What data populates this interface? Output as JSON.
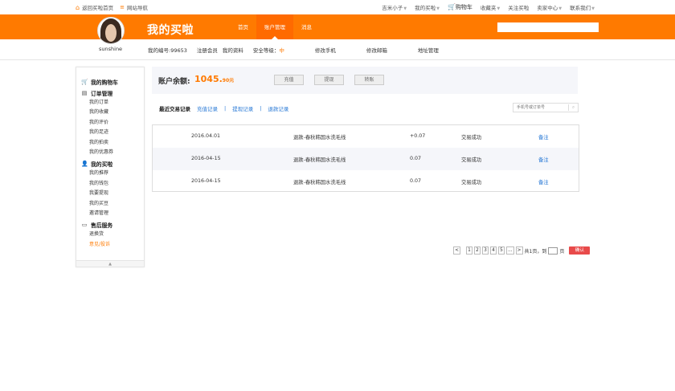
{
  "topbar": {
    "home_link": "返回买啦首页",
    "site_nav": "网站导航",
    "user": "吉米小子",
    "my_maila": "我的买啦",
    "cart": "购物车",
    "favorites": "收藏夹",
    "follow": "关注买啦",
    "seller_center": "卖家中心",
    "contact": "联系我们"
  },
  "header": {
    "logo": "我的买啦",
    "nav": [
      "首页",
      "账户管理",
      "消息"
    ],
    "active_index": 1,
    "accent": "#ff7a00"
  },
  "subbar": {
    "username": "sunshine",
    "member_no": "我的编号:99653",
    "register_member": "注册会员",
    "my_profile": "我的资料",
    "security_label": "安全等级：",
    "security_value": "中",
    "change_phone": "修改手机",
    "change_email": "修改邮箱",
    "address": "地址管理"
  },
  "sidebar": {
    "sections": [
      {
        "title": "我的购物车",
        "icon": "cart-icon",
        "items": []
      },
      {
        "title": "订单管理",
        "icon": "document-icon",
        "items": [
          "我的订单",
          "我的收藏",
          "我的评价",
          "我的足迹",
          "我的拍卖",
          "我的优惠券"
        ]
      },
      {
        "title": "我的买啦",
        "icon": "user-icon",
        "items": [
          "我的推荐",
          "我的钱包",
          "我要提现",
          "我的买豆",
          "邀请管理"
        ]
      },
      {
        "title": "售后服务",
        "icon": "card-icon",
        "items": [
          "退换货",
          "意见/投诉"
        ]
      }
    ],
    "highlight_item": "意见/投诉"
  },
  "balance": {
    "label": "账户余额:",
    "amount": "1045.",
    "amount_suffix": "90元",
    "btn_recharge": "充值",
    "btn_withdraw": "提现",
    "btn_transfer": "转账"
  },
  "records": {
    "title": "最近交易记录",
    "tabs": [
      "充值记录",
      "提现记录",
      "退款记录"
    ],
    "search_placeholder": "手机号或订单号"
  },
  "table": {
    "rows": [
      {
        "date": "2016.04.01",
        "desc": "退款-春秋韩国水洗毛线",
        "amount": "+0.07",
        "status": "交易成功",
        "note": "备注"
      },
      {
        "date": "2016-04-15",
        "desc": "退款-春秋韩国水洗毛线",
        "amount": "0.07",
        "status": "交易成功",
        "note": "备注"
      },
      {
        "date": "2016-04-15",
        "desc": "退款-春秋韩国水洗毛线",
        "amount": "0.07",
        "status": "交易成功",
        "note": "备注"
      }
    ]
  },
  "pager": {
    "prev": "<",
    "pages": [
      "1",
      "2",
      "3",
      "4",
      "5"
    ],
    "ellipsis": "...",
    "next": ">",
    "total": "共1页，到",
    "page_unit": "页",
    "confirm": "确认"
  }
}
